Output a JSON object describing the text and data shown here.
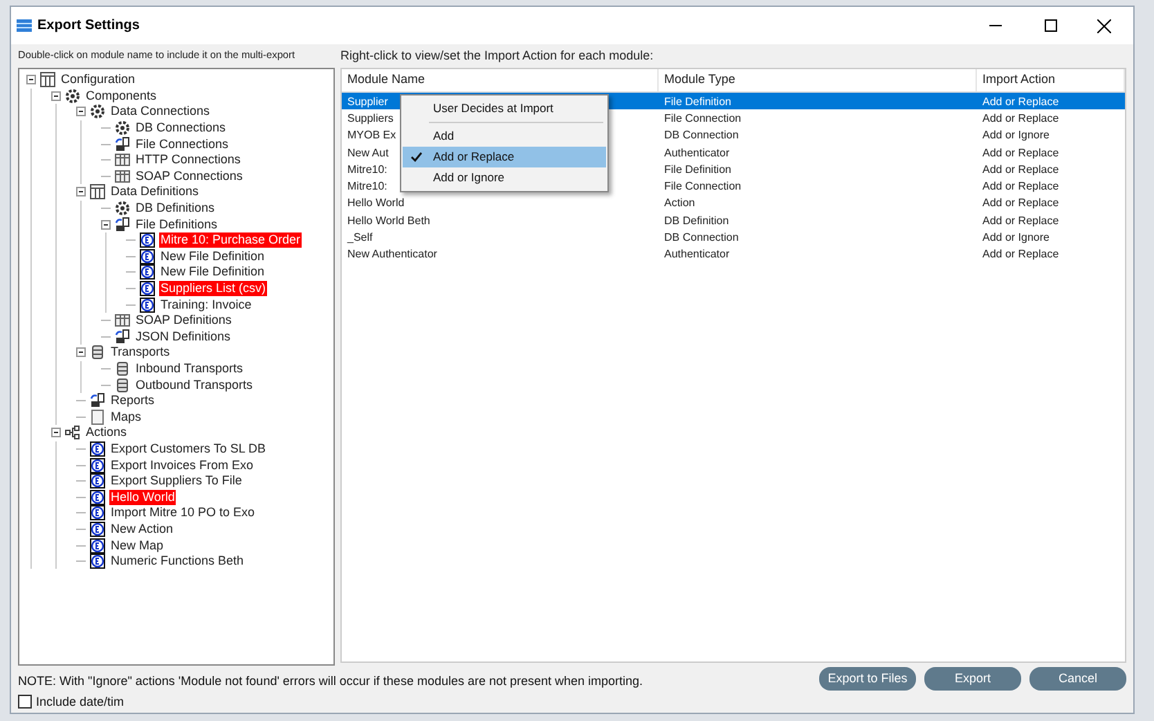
{
  "window": {
    "title": "Export Settings"
  },
  "left": {
    "instruction": "Double-click on module name to include it on the multi-export",
    "tree": [
      {
        "label": "Configuration",
        "kind": "table",
        "expanded": true,
        "highlighted": false,
        "children": [
          {
            "label": "Components",
            "kind": "gear",
            "expanded": true,
            "highlighted": false,
            "children": [
              {
                "label": "Data Connections",
                "kind": "gear",
                "expanded": true,
                "highlighted": false,
                "children": [
                  {
                    "label": "DB Connections",
                    "kind": "gear",
                    "highlighted": false
                  },
                  {
                    "label": "File Connections",
                    "kind": "file",
                    "highlighted": false
                  },
                  {
                    "label": "HTTP Connections",
                    "kind": "grid",
                    "highlighted": false
                  },
                  {
                    "label": "SOAP Connections",
                    "kind": "grid",
                    "highlighted": false
                  }
                ]
              },
              {
                "label": "Data Definitions",
                "kind": "table",
                "expanded": true,
                "highlighted": false,
                "children": [
                  {
                    "label": "DB Definitions",
                    "kind": "gear",
                    "highlighted": false
                  },
                  {
                    "label": "File Definitions",
                    "kind": "file",
                    "expanded": true,
                    "highlighted": false,
                    "children": [
                      {
                        "label": "Mitre 10: Purchase Order",
                        "kind": "module",
                        "highlighted": true
                      },
                      {
                        "label": "New File Definition",
                        "kind": "module",
                        "highlighted": false
                      },
                      {
                        "label": "New File Definition",
                        "kind": "module",
                        "highlighted": false
                      },
                      {
                        "label": "Suppliers List (csv)",
                        "kind": "module",
                        "highlighted": true
                      },
                      {
                        "label": "Training: Invoice",
                        "kind": "module",
                        "highlighted": false
                      }
                    ]
                  },
                  {
                    "label": "SOAP Definitions",
                    "kind": "grid",
                    "highlighted": false
                  },
                  {
                    "label": "JSON Definitions",
                    "kind": "file",
                    "highlighted": false
                  }
                ]
              },
              {
                "label": "Transports",
                "kind": "db",
                "expanded": true,
                "highlighted": false,
                "children": [
                  {
                    "label": "Inbound Transports",
                    "kind": "db",
                    "highlighted": false
                  },
                  {
                    "label": "Outbound Transports",
                    "kind": "db",
                    "highlighted": false
                  }
                ]
              },
              {
                "label": "Reports",
                "kind": "file",
                "highlighted": false
              },
              {
                "label": "Maps",
                "kind": "doc",
                "highlighted": false
              }
            ]
          },
          {
            "label": "Actions",
            "kind": "flow",
            "expanded": true,
            "highlighted": false,
            "children": [
              {
                "label": "Export Customers To SL DB",
                "kind": "module",
                "highlighted": false
              },
              {
                "label": "Export Invoices From Exo",
                "kind": "module",
                "highlighted": false
              },
              {
                "label": "Export Suppliers To File",
                "kind": "module",
                "highlighted": false
              },
              {
                "label": "Hello World",
                "kind": "module",
                "highlighted": true
              },
              {
                "label": "Import Mitre 10 PO to Exo",
                "kind": "module",
                "highlighted": false
              },
              {
                "label": "New Action",
                "kind": "module",
                "highlighted": false
              },
              {
                "label": "New Map",
                "kind": "module",
                "highlighted": false
              },
              {
                "label": "Numeric Functions Beth",
                "kind": "module",
                "highlighted": false
              }
            ]
          }
        ]
      }
    ]
  },
  "right": {
    "instruction": "Right-click to view/set the Import Action for each module:",
    "table": {
      "columns": [
        "Module Name",
        "Module Type",
        "Import Action"
      ],
      "rows": [
        {
          "cells": [
            "Supplier",
            "File Definition",
            "Add or Replace"
          ],
          "selected": true
        },
        {
          "cells": [
            "Suppliers",
            "File Connection",
            "Add or Replace"
          ],
          "selected": false
        },
        {
          "cells": [
            "MYOB Ex",
            "DB Connection",
            "Add or Ignore"
          ],
          "selected": false
        },
        {
          "cells": [
            "New Aut",
            "Authenticator",
            "Add or Replace"
          ],
          "selected": false
        },
        {
          "cells": [
            "Mitre10:",
            "File Definition",
            "Add or Replace"
          ],
          "selected": false
        },
        {
          "cells": [
            "Mitre10:",
            "File Connection",
            "Add or Replace"
          ],
          "selected": false
        },
        {
          "cells": [
            "Hello World",
            "Action",
            "Add or Replace"
          ],
          "selected": false
        },
        {
          "cells": [
            "Hello World Beth",
            "DB Definition",
            "Add or Replace"
          ],
          "selected": false
        },
        {
          "cells": [
            "_Self",
            "DB Connection",
            "Add or Ignore"
          ],
          "selected": false
        },
        {
          "cells": [
            "New Authenticator",
            "Authenticator",
            "Add or Replace"
          ],
          "selected": false
        }
      ]
    }
  },
  "context_menu": [
    {
      "kind": "item",
      "label": "User Decides at Import",
      "checked": false,
      "highlighted": false
    },
    {
      "kind": "separator"
    },
    {
      "kind": "item",
      "label": "Add",
      "checked": false,
      "highlighted": false
    },
    {
      "kind": "item",
      "label": "Add or Replace",
      "checked": true,
      "highlighted": true
    },
    {
      "kind": "item",
      "label": "Add or Ignore",
      "checked": false,
      "highlighted": false
    }
  ],
  "footer": {
    "note": "NOTE: With \"Ignore\" actions 'Module not found' errors will occur if these modules are not present when importing.",
    "checkbox": {
      "label": "Include date/tim",
      "checked": false
    },
    "buttons": [
      "Export to Files",
      "Export",
      "Cancel"
    ]
  }
}
